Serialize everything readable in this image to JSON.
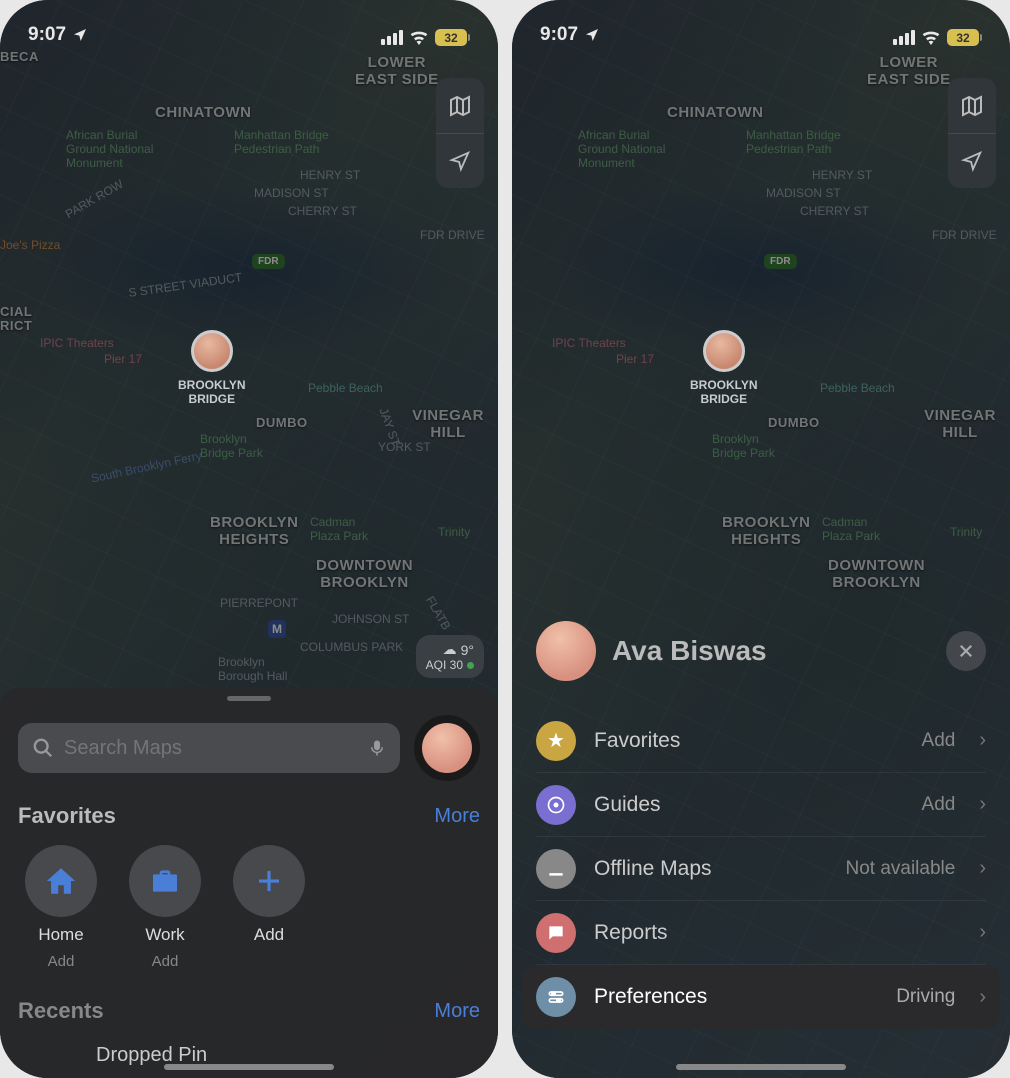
{
  "status": {
    "time": "9:07",
    "battery": "32"
  },
  "map": {
    "labels": {
      "lower_east_side": "LOWER\nEAST SIDE",
      "chinatown": "CHINATOWN",
      "brooklyn_heights": "BROOKLYN\nHEIGHTS",
      "downtown_brooklyn": "DOWNTOWN\nBROOKLYN",
      "vinegar_hill": "VINEGAR HILL",
      "dumbo": "DUMBO",
      "tribeca": "BECA",
      "financial": "CIAL\nRICT"
    },
    "pois": {
      "african_burial": "African Burial\nGround National\nMonument",
      "manhattan_bridge": "Manhattan Bridge\nPedestrian Path",
      "madison": "MADISON ST",
      "henry": "HENRY ST",
      "cherry": "CHERRY ST",
      "fdr": "FDR DRIVE",
      "park_row": "PARK ROW",
      "viaduct": "S STREET VIADUCT",
      "ipic": "IPIC Theaters",
      "pier17": "Pier 17",
      "joes": "Joe's Pizza",
      "pebble": "Pebble Beach",
      "bb_park": "Brooklyn\nBridge Park",
      "cadman": "Cadman\nPlaza Park",
      "trinity": "Trinity",
      "columbus": "COLUMBUS PARK",
      "borough_hall": "Brooklyn\nBorough Hall",
      "pierrepont": "PIERREPONT",
      "johnson": "JOHNSON ST",
      "york": "YORK ST",
      "jay": "JAY ST",
      "flatb": "FLATB",
      "ferry": "South Brooklyn Ferry",
      "fdr_badge": "FDR"
    },
    "pin_label": "BROOKLYN\nBRIDGE",
    "weather": {
      "temp": "9°",
      "aqi": "AQI 30"
    }
  },
  "search": {
    "placeholder": "Search Maps"
  },
  "favorites": {
    "title": "Favorites",
    "more": "More",
    "items": [
      {
        "label": "Home",
        "sub": "Add"
      },
      {
        "label": "Work",
        "sub": "Add"
      },
      {
        "label": "Add",
        "sub": ""
      }
    ]
  },
  "recents": {
    "title": "Recents",
    "more": "More",
    "first_item": "Dropped Pin"
  },
  "profile": {
    "name": "Ava Biswas",
    "menu": [
      {
        "label": "Favorites",
        "trail": "Add"
      },
      {
        "label": "Guides",
        "trail": "Add"
      },
      {
        "label": "Offline Maps",
        "trail": "Not available"
      },
      {
        "label": "Reports",
        "trail": ""
      },
      {
        "label": "Preferences",
        "trail": "Driving"
      }
    ]
  }
}
